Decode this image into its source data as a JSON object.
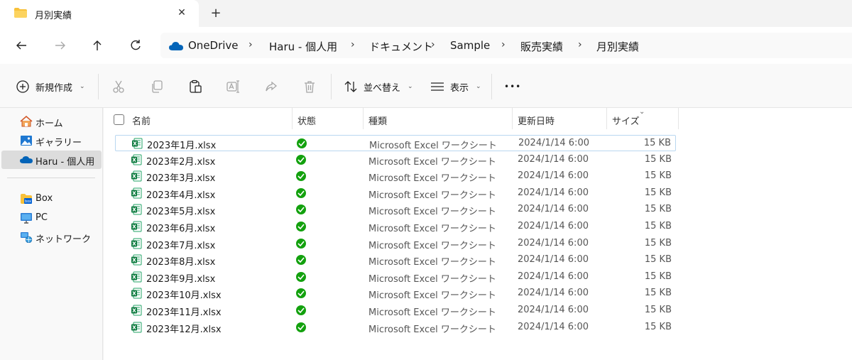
{
  "tab": {
    "title": "月別実績",
    "close": "✕",
    "new_tab": "+"
  },
  "breadcrumb": {
    "items": [
      "OneDrive",
      "Haru - 個人用",
      "ドキュメント",
      "Sample",
      "販売実績",
      "月別実績"
    ],
    "separator": "›"
  },
  "commands": {
    "new": "新規作成",
    "sort": "並べ替え",
    "view": "表示",
    "more": "•••"
  },
  "sidebar": {
    "items": [
      {
        "label": "ホーム",
        "icon": "home-icon"
      },
      {
        "label": "ギャラリー",
        "icon": "gallery-icon"
      },
      {
        "label": "Haru - 個人用",
        "icon": "onedrive-icon",
        "selected": true
      },
      {
        "label": "Box",
        "icon": "box-icon"
      },
      {
        "label": "PC",
        "icon": "pc-icon"
      },
      {
        "label": "ネットワーク",
        "icon": "network-icon"
      }
    ]
  },
  "columns": {
    "name": "名前",
    "status": "状態",
    "type": "種類",
    "modified": "更新日時",
    "size": "サイズ"
  },
  "files": [
    {
      "name": "2023年1月.xlsx",
      "type": "Microsoft Excel ワークシート",
      "modified": "2024/1/14 6:00",
      "size": "15 KB"
    },
    {
      "name": "2023年2月.xlsx",
      "type": "Microsoft Excel ワークシート",
      "modified": "2024/1/14 6:00",
      "size": "15 KB"
    },
    {
      "name": "2023年3月.xlsx",
      "type": "Microsoft Excel ワークシート",
      "modified": "2024/1/14 6:00",
      "size": "15 KB"
    },
    {
      "name": "2023年4月.xlsx",
      "type": "Microsoft Excel ワークシート",
      "modified": "2024/1/14 6:00",
      "size": "15 KB"
    },
    {
      "name": "2023年5月.xlsx",
      "type": "Microsoft Excel ワークシート",
      "modified": "2024/1/14 6:00",
      "size": "15 KB"
    },
    {
      "name": "2023年6月.xlsx",
      "type": "Microsoft Excel ワークシート",
      "modified": "2024/1/14 6:00",
      "size": "15 KB"
    },
    {
      "name": "2023年7月.xlsx",
      "type": "Microsoft Excel ワークシート",
      "modified": "2024/1/14 6:00",
      "size": "15 KB"
    },
    {
      "name": "2023年8月.xlsx",
      "type": "Microsoft Excel ワークシート",
      "modified": "2024/1/14 6:00",
      "size": "15 KB"
    },
    {
      "name": "2023年9月.xlsx",
      "type": "Microsoft Excel ワークシート",
      "modified": "2024/1/14 6:00",
      "size": "15 KB"
    },
    {
      "name": "2023年10月.xlsx",
      "type": "Microsoft Excel ワークシート",
      "modified": "2024/1/14 6:00",
      "size": "15 KB"
    },
    {
      "name": "2023年11月.xlsx",
      "type": "Microsoft Excel ワークシート",
      "modified": "2024/1/14 6:00",
      "size": "15 KB"
    },
    {
      "name": "2023年12月.xlsx",
      "type": "Microsoft Excel ワークシート",
      "modified": "2024/1/14 6:00",
      "size": "15 KB"
    }
  ],
  "colors": {
    "excel_green": "#107c41",
    "sync_green": "#13a10e",
    "onedrive_blue": "#0364b8",
    "folder_yellow": "#f8c13a"
  }
}
